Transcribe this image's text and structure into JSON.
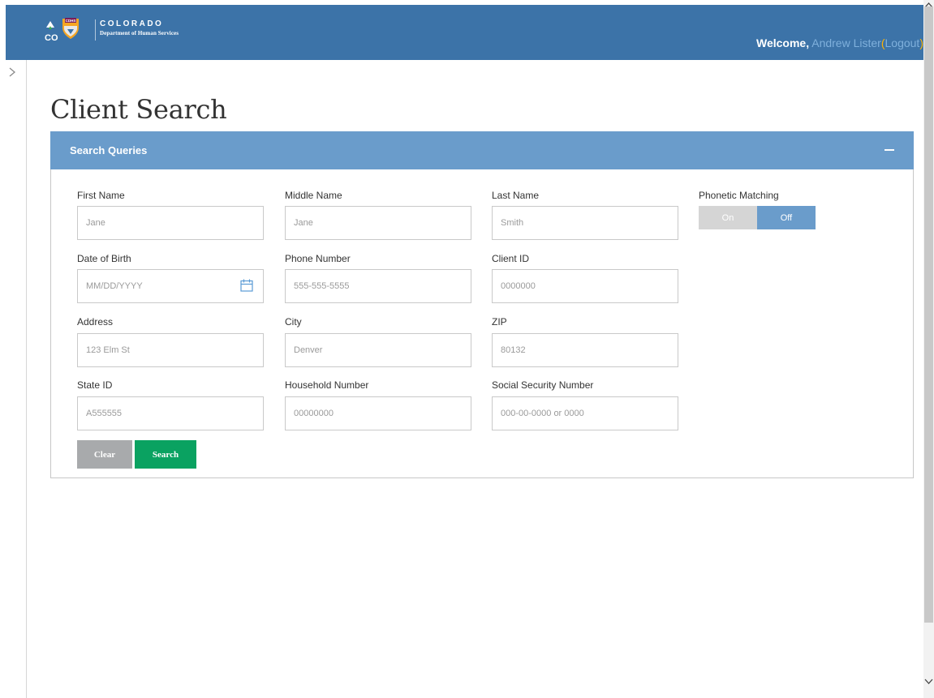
{
  "header": {
    "brand_name": "COLORADO",
    "brand_sub": "Department of Human Services",
    "logo_text": "CO",
    "logo_badge": "CDHS",
    "welcome_label": "Welcome,",
    "user_name": "Andrew Lister",
    "paren_open": "(",
    "logout_label": "Logout",
    "paren_close": ")"
  },
  "page": {
    "title": "Client Search"
  },
  "panel": {
    "title": "Search Queries"
  },
  "fields": {
    "first_name": {
      "label": "First Name",
      "placeholder": "Jane"
    },
    "middle_name": {
      "label": "Middle Name",
      "placeholder": "Jane"
    },
    "last_name": {
      "label": "Last Name",
      "placeholder": "Smith"
    },
    "date_of_birth": {
      "label": "Date of Birth",
      "placeholder": "MM/DD/YYYY"
    },
    "phone_number": {
      "label": "Phone Number",
      "placeholder": "555-555-5555"
    },
    "client_id": {
      "label": "Client ID",
      "placeholder": "0000000"
    },
    "address": {
      "label": "Address",
      "placeholder": "123 Elm St"
    },
    "city": {
      "label": "City",
      "placeholder": "Denver"
    },
    "zip": {
      "label": "ZIP",
      "placeholder": "80132"
    },
    "state_id": {
      "label": "State ID",
      "placeholder": "A555555"
    },
    "household_number": {
      "label": "Household Number",
      "placeholder": "00000000"
    },
    "ssn": {
      "label": "Social Security Number",
      "placeholder": "000-00-0000 or 0000"
    }
  },
  "phonetic": {
    "label": "Phonetic Matching",
    "on_label": "On",
    "off_label": "Off",
    "selected": "Off"
  },
  "buttons": {
    "clear_label": "Clear",
    "search_label": "Search"
  },
  "colors": {
    "header_bg": "#3c73a8",
    "panel_header_bg": "#6a9ccb",
    "search_button": "#0aa261",
    "clear_button": "#a8aaac",
    "link": "#7fb0dc",
    "paren_accent": "#ffb300"
  },
  "icons": {
    "calendar": "calendar-icon",
    "collapse": "minus-icon",
    "sidenav": "chevron-right-icon"
  }
}
